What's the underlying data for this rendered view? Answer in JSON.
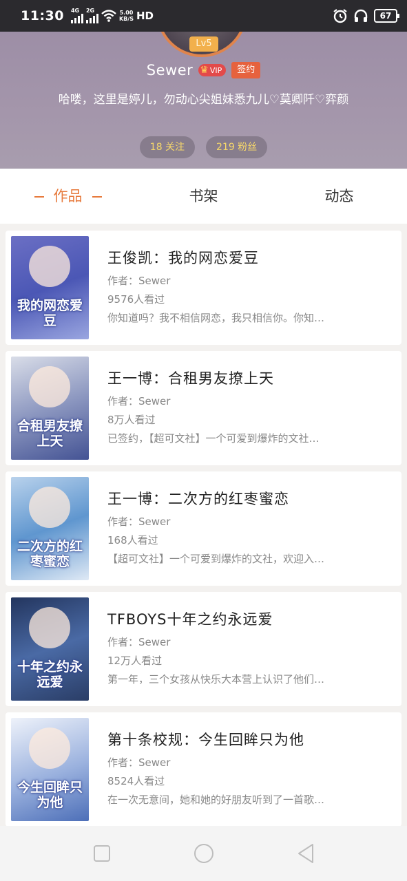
{
  "status": {
    "time": "11:30",
    "net1": "4G",
    "net2": "2G",
    "speed_top": "5.00",
    "speed_bottom": "KB/S",
    "hd": "HD",
    "battery": "67"
  },
  "profile": {
    "level": "Lv5",
    "name": "Sewer",
    "vip_label": "VIP",
    "signed_label": "签约",
    "bio": "哈喽，这里是婷儿，勿动心尖姐妹悉九儿♡莫卿阡♡弈颜",
    "following": "18 关注",
    "followers": "219 粉丝"
  },
  "tabs": [
    "作品",
    "书架",
    "动态"
  ],
  "works": [
    {
      "title": "王俊凯：我的网恋爱豆",
      "author": "作者：Sewer",
      "views": "9576人看过",
      "desc": "你知道吗？我不相信网恋，我只相信你。你知…",
      "cover_text": "我的网恋爱豆"
    },
    {
      "title": "王一博：合租男友撩上天",
      "author": "作者：Sewer",
      "views": "8万人看过",
      "desc": "已签约，【超可文社】一个可爱到爆炸的文社…",
      "cover_text": "合租男友撩上天"
    },
    {
      "title": "王一博：二次方的红枣蜜恋",
      "author": "作者：Sewer",
      "views": "168人看过",
      "desc": "【超可文社】一个可爱到爆炸的文社，欢迎入…",
      "cover_text": "二次方的红枣蜜恋"
    },
    {
      "title": "TFBOYS十年之约永远爱",
      "author": "作者：Sewer",
      "views": "12万人看过",
      "desc": "第一年，三个女孩从快乐大本营上认识了他们…",
      "cover_text": "十年之约永远爱"
    },
    {
      "title": "第十条校规：今生回眸只为他",
      "author": "作者：Sewer",
      "views": "8524人看过",
      "desc": "在一次无意间，她和她的好朋友听到了一首歌…",
      "cover_text": "今生回眸只为他"
    }
  ],
  "nav": {
    "recent": "square-icon",
    "home": "circle-icon",
    "back": "triangle-back-icon"
  },
  "colors": {
    "accent": "#e77a3c",
    "header": "#a496ab",
    "stat_text": "#f7d86a"
  }
}
